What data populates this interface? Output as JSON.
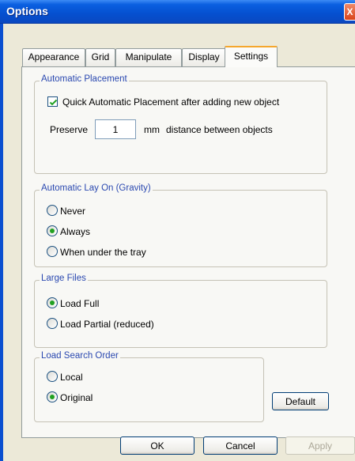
{
  "window": {
    "title": "Options",
    "close_glyph": "X"
  },
  "tabs": [
    {
      "label": "Appearance"
    },
    {
      "label": "Grid"
    },
    {
      "label": "Manipulate"
    },
    {
      "label": "Display"
    },
    {
      "label": "Settings",
      "active": true
    }
  ],
  "automatic_placement": {
    "legend": "Automatic Placement",
    "quick_checkbox_label": "Quick Automatic Placement after adding new object",
    "quick_checked": true,
    "preserve_label": "Preserve",
    "preserve_value": "1",
    "unit_label": "mm",
    "distance_label": "distance between objects"
  },
  "lay_on": {
    "legend": "Automatic Lay On (Gravity)",
    "options": [
      "Never",
      "Always",
      "When under the tray"
    ],
    "selected": "Always"
  },
  "large_files": {
    "legend": "Large Files",
    "options": [
      "Load Full",
      "Load Partial (reduced)"
    ],
    "selected": "Load Full"
  },
  "load_search_order": {
    "legend": "Load Search Order",
    "options": [
      "Local",
      "Original"
    ],
    "selected": "Original"
  },
  "buttons": {
    "default_label": "Default",
    "ok_label": "OK",
    "cancel_label": "Cancel",
    "apply_label": "Apply"
  }
}
